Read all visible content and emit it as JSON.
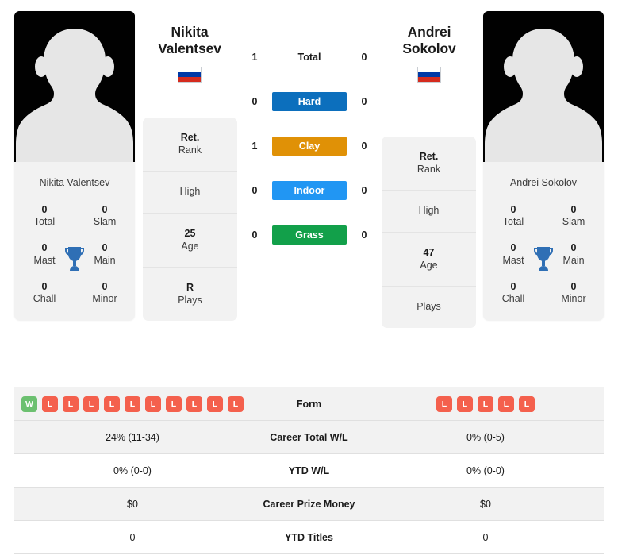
{
  "players": {
    "left": {
      "first_name": "Nikita",
      "last_name": "Valentsev",
      "full_name": "Nikita Valentsev",
      "country_flag": "russia-flag",
      "avatar": "player-silhouette-placeholder",
      "titles": [
        {
          "num": "0",
          "label": "Total"
        },
        {
          "num": "0",
          "label": "Slam"
        },
        {
          "num": "0",
          "label": "Mast"
        },
        {
          "num": "0",
          "label": "Main"
        },
        {
          "num": "0",
          "label": "Chall"
        },
        {
          "num": "0",
          "label": "Minor"
        }
      ],
      "info": [
        {
          "value": "Ret.",
          "label": "Rank"
        },
        {
          "value": "",
          "label": "High"
        },
        {
          "value": "25",
          "label": "Age"
        },
        {
          "value": "R",
          "label": "Plays"
        }
      ],
      "form": [
        "W",
        "L",
        "L",
        "L",
        "L",
        "L",
        "L",
        "L",
        "L",
        "L",
        "L"
      ]
    },
    "right": {
      "first_name": "Andrei",
      "last_name": "Sokolov",
      "full_name": "Andrei Sokolov",
      "country_flag": "russia-flag",
      "avatar": "player-silhouette-placeholder",
      "titles": [
        {
          "num": "0",
          "label": "Total"
        },
        {
          "num": "0",
          "label": "Slam"
        },
        {
          "num": "0",
          "label": "Mast"
        },
        {
          "num": "0",
          "label": "Main"
        },
        {
          "num": "0",
          "label": "Chall"
        },
        {
          "num": "0",
          "label": "Minor"
        }
      ],
      "info": [
        {
          "value": "Ret.",
          "label": "Rank"
        },
        {
          "value": "",
          "label": "High"
        },
        {
          "value": "47",
          "label": "Age"
        },
        {
          "value": "",
          "label": "Plays"
        }
      ],
      "form": [
        "L",
        "L",
        "L",
        "L",
        "L"
      ]
    }
  },
  "head_to_head": [
    {
      "left": "1",
      "surface": "Total",
      "right": "0",
      "color": "",
      "plain": true
    },
    {
      "left": "0",
      "surface": "Hard",
      "right": "0",
      "color": "#0c6fbd",
      "plain": false
    },
    {
      "left": "1",
      "surface": "Clay",
      "right": "0",
      "color": "#e09106",
      "plain": false
    },
    {
      "left": "0",
      "surface": "Indoor",
      "right": "0",
      "color": "#2196f3",
      "plain": false
    },
    {
      "left": "0",
      "surface": "Grass",
      "right": "0",
      "color": "#12a04a",
      "plain": false
    }
  ],
  "comparison": {
    "form_label": "Form",
    "rows": [
      {
        "left": "24% (11-34)",
        "label": "Career Total W/L",
        "right": "0% (0-5)"
      },
      {
        "left": "0% (0-0)",
        "label": "YTD W/L",
        "right": "0% (0-0)"
      },
      {
        "left": "$0",
        "label": "Career Prize Money",
        "right": "$0"
      },
      {
        "left": "0",
        "label": "YTD Titles",
        "right": "0"
      }
    ]
  },
  "colors": {
    "win_badge": "#6cc070",
    "loss_badge": "#f4604d",
    "card_bg": "#f2f2f2",
    "trophy": "#2f6fb5",
    "flag_white": "#ffffff",
    "flag_blue": "#0039a6",
    "flag_red": "#d52b1e"
  }
}
